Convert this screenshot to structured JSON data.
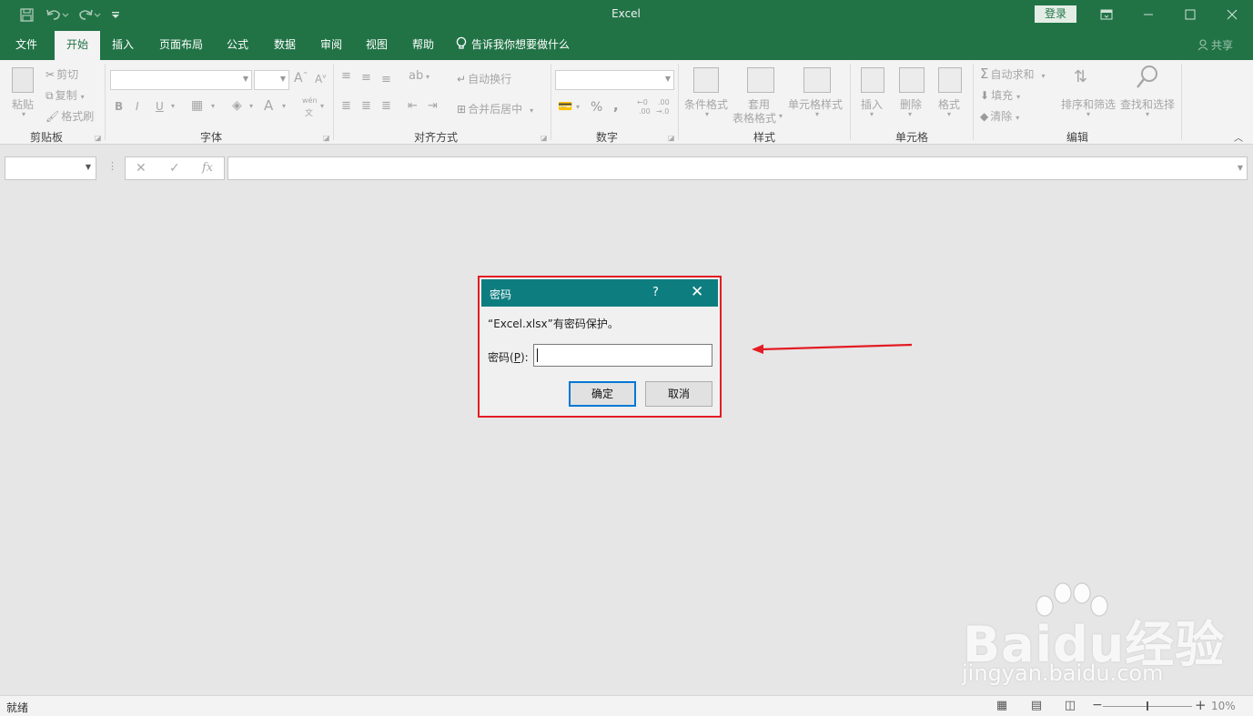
{
  "window": {
    "app_title": "Excel",
    "login_label": "登录",
    "share_label": "共享",
    "accent_color": "#217346"
  },
  "qat": {
    "save_icon": "save-icon",
    "undo_icon": "undo-icon",
    "redo_icon": "redo-icon",
    "customize_icon": "customize-qat-icon"
  },
  "tabs": [
    {
      "label": "文件"
    },
    {
      "label": "开始",
      "active": true
    },
    {
      "label": "插入"
    },
    {
      "label": "页面布局"
    },
    {
      "label": "公式"
    },
    {
      "label": "数据"
    },
    {
      "label": "审阅"
    },
    {
      "label": "视图"
    },
    {
      "label": "帮助"
    },
    {
      "label": "告诉我你想要做什么"
    }
  ],
  "ribbon": {
    "clipboard": {
      "paste": "粘贴",
      "cut": "剪切",
      "copy": "复制",
      "format_painter": "格式刷",
      "group": "剪贴板"
    },
    "font": {
      "bold": "B",
      "italic": "I",
      "underline": "U",
      "grow": "A",
      "shrink": "A",
      "font_color": "A",
      "wen": "wén",
      "wen_char": "文",
      "group": "字体"
    },
    "alignment": {
      "wrap_text": "自动换行",
      "merge_center": "合并后居中",
      "group": "对齐方式"
    },
    "number": {
      "percent": "%",
      "comma": ",",
      "inc_decimal_top": "←0",
      "inc_decimal_bottom": ".00",
      "dec_decimal_top": ".00",
      "dec_decimal_bottom": "→.0",
      "group": "数字"
    },
    "styles": {
      "conditional": "条件格式",
      "table_line1": "套用",
      "table_line2": "表格格式",
      "cell_styles": "单元格样式",
      "group": "样式"
    },
    "cells": {
      "insert": "插入",
      "delete": "删除",
      "format": "格式",
      "group": "单元格"
    },
    "editing": {
      "autosum": "自动求和",
      "fill": "填充",
      "clear": "清除",
      "sort_filter": "排序和筛选",
      "find_select": "查找和选择",
      "group": "编辑"
    }
  },
  "formula_bar": {
    "cancel_glyph": "✕",
    "enter_glyph": "✓",
    "fx_glyph": "fx",
    "value": ""
  },
  "dialog": {
    "title": "密码",
    "help": "?",
    "close": "✕",
    "message": "“Excel.xlsx”有密码保护。",
    "password_label_pre": "密码(",
    "password_label_key": "P",
    "password_label_post": "):",
    "password_value": "",
    "ok": "确定",
    "cancel": "取消",
    "highlight_color": "#e31c23"
  },
  "status": {
    "ready": "就绪",
    "zoom": "10%"
  },
  "watermark": {
    "brand": "Baidu经验",
    "url": "jingyan.baidu.com"
  }
}
